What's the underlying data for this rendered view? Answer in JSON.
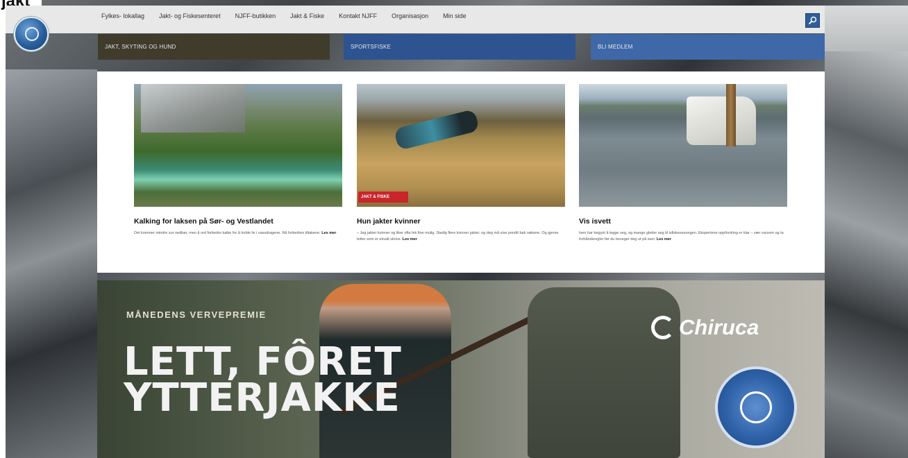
{
  "page_title_fragment": "jakt",
  "nav": {
    "items": [
      "Fylkes- lokallag",
      "Jakt- og Fiskesenteret",
      "NJFF-butikken",
      "Jakt & Fiske",
      "Kontakt NJFF",
      "Organisasjon",
      "Min side"
    ]
  },
  "tabs": {
    "hunting": "JAKT, SKYTING OG HUND",
    "fishing": "SPORTSFISKE",
    "join": "BLI MEDLEM"
  },
  "articles": [
    {
      "title": "Kalking for laksen på Sør- og Vestlandet",
      "body": "Det kommer mindre sur nedbør, men å ord forbedre kalke for å holde liv i vassdragene. Nå forbedres tiltakene.",
      "more": "Les mer"
    },
    {
      "title": "Hun jakter kvinner",
      "body": "– Jeg jakter kvinner og liker ofte lek fine mulig. Stadig flere kvinner jakter, og deg må vise pondit bak nøkene. Og gjerne tetter som er ekvalt skrive.",
      "more": "Les mer",
      "badge": "JAKT & FISKE"
    },
    {
      "title": "Vis isvett",
      "body": "Isen har begynt å legge seg, og mange gleder seg til isfiskesesongen. Ekspertene oppfordring er klar – vær varsom og ta forhåndsregler før du beveger deg ut på isen.",
      "more": "Les mer"
    }
  ],
  "banner": {
    "kicker": "MÅNEDENS VERVEPREMIE",
    "headline_line1": "LETT, FÔRET",
    "headline_line2": "YTTERJAKKE",
    "brand": "Chiruca"
  },
  "colors": {
    "tab_hunting": "#3f3c2c",
    "tab_fishing": "#2d5490",
    "tab_join": "#3f68a8",
    "badge_red": "#c8262b"
  }
}
